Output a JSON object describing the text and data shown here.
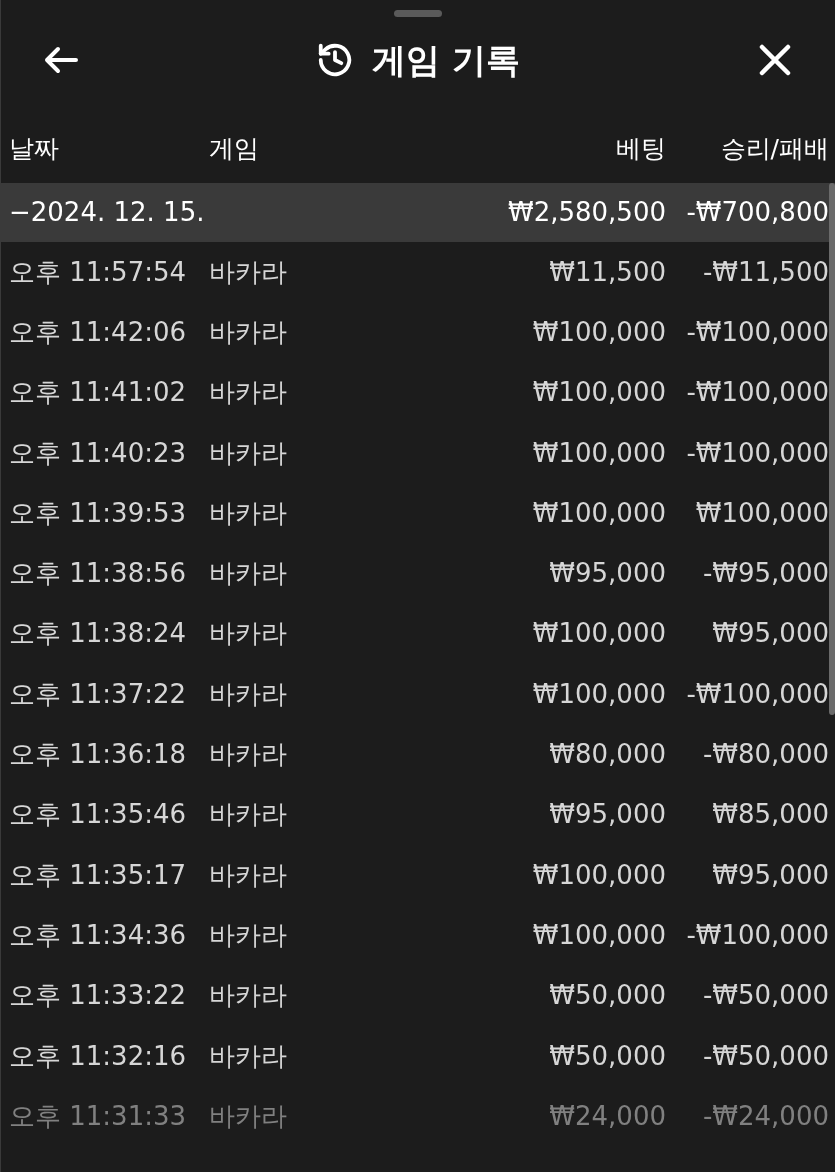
{
  "header": {
    "title": "게임 기록"
  },
  "table": {
    "columns": [
      "날짜",
      "게임",
      "베팅",
      "승리/패배"
    ],
    "group": {
      "date": "−2024. 12. 15.",
      "bet": "₩2,580,500",
      "result": "-₩700,800"
    },
    "rows": [
      {
        "time": "오후 11:57:54",
        "game": "바카라",
        "bet": "₩11,500",
        "result": "-₩11,500",
        "faded": false
      },
      {
        "time": "오후 11:42:06",
        "game": "바카라",
        "bet": "₩100,000",
        "result": "-₩100,000",
        "faded": false
      },
      {
        "time": "오후 11:41:02",
        "game": "바카라",
        "bet": "₩100,000",
        "result": "-₩100,000",
        "faded": false
      },
      {
        "time": "오후 11:40:23",
        "game": "바카라",
        "bet": "₩100,000",
        "result": "-₩100,000",
        "faded": false
      },
      {
        "time": "오후 11:39:53",
        "game": "바카라",
        "bet": "₩100,000",
        "result": "₩100,000",
        "faded": false
      },
      {
        "time": "오후 11:38:56",
        "game": "바카라",
        "bet": "₩95,000",
        "result": "-₩95,000",
        "faded": false
      },
      {
        "time": "오후 11:38:24",
        "game": "바카라",
        "bet": "₩100,000",
        "result": "₩95,000",
        "faded": false
      },
      {
        "time": "오후 11:37:22",
        "game": "바카라",
        "bet": "₩100,000",
        "result": "-₩100,000",
        "faded": false
      },
      {
        "time": "오후 11:36:18",
        "game": "바카라",
        "bet": "₩80,000",
        "result": "-₩80,000",
        "faded": false
      },
      {
        "time": "오후 11:35:46",
        "game": "바카라",
        "bet": "₩95,000",
        "result": "₩85,000",
        "faded": false
      },
      {
        "time": "오후 11:35:17",
        "game": "바카라",
        "bet": "₩100,000",
        "result": "₩95,000",
        "faded": false
      },
      {
        "time": "오후 11:34:36",
        "game": "바카라",
        "bet": "₩100,000",
        "result": "-₩100,000",
        "faded": false
      },
      {
        "time": "오후 11:33:22",
        "game": "바카라",
        "bet": "₩50,000",
        "result": "-₩50,000",
        "faded": false
      },
      {
        "time": "오후 11:32:16",
        "game": "바카라",
        "bet": "₩50,000",
        "result": "-₩50,000",
        "faded": false
      },
      {
        "time": "오후 11:31:33",
        "game": "바카라",
        "bet": "₩24,000",
        "result": "-₩24,000",
        "faded": true
      }
    ]
  }
}
